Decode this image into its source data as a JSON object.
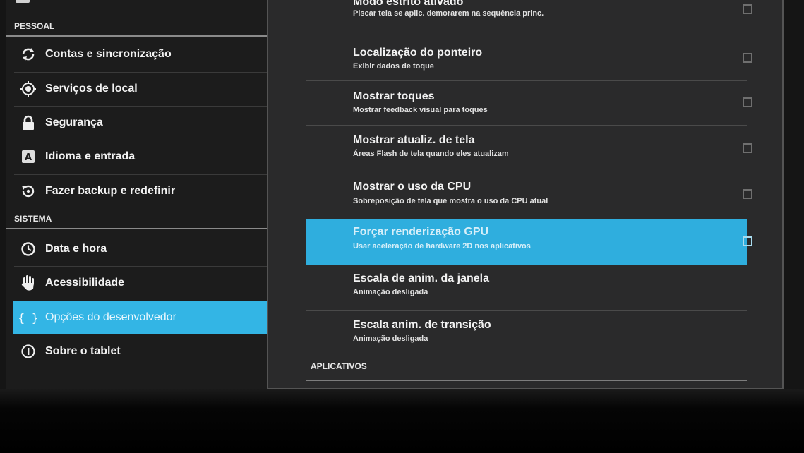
{
  "sidebar": {
    "section_personal": "PESSOAL",
    "section_system": "SISTEMA",
    "items": [
      {
        "label": "Contas e sincronização",
        "icon": "sync-icon"
      },
      {
        "label": "Serviços de local",
        "icon": "location-icon"
      },
      {
        "label": "Segurança",
        "icon": "lock-icon"
      },
      {
        "label": "Idioma e entrada",
        "icon": "language-icon"
      },
      {
        "label": "Fazer backup e redefinir",
        "icon": "backup-icon"
      },
      {
        "label": "Data e hora",
        "icon": "clock-icon"
      },
      {
        "label": "Acessibilidade",
        "icon": "hand-icon"
      },
      {
        "label": "Opções do desenvolvedor",
        "icon": "braces-icon",
        "selected": true
      },
      {
        "label": "Sobre o tablet",
        "icon": "info-icon"
      }
    ]
  },
  "prefs": [
    {
      "title": "Modo estrito ativado",
      "summary": "Piscar tela se aplic. demorarem na sequência princ.",
      "checkbox": true,
      "checked": false
    },
    {
      "title": "Localização do ponteiro",
      "summary": "Exibir dados de toque",
      "checkbox": true,
      "checked": false
    },
    {
      "title": "Mostrar toques",
      "summary": "Mostrar feedback visual para toques",
      "checkbox": true,
      "checked": false
    },
    {
      "title": "Mostrar atualiz. de tela",
      "summary": "Áreas Flash de tela quando eles atualizam",
      "checkbox": true,
      "checked": false
    },
    {
      "title": "Mostrar o uso da CPU",
      "summary": "Sobreposição de tela que mostra o uso da CPU atual",
      "checkbox": true,
      "checked": false
    },
    {
      "title": "Forçar renderização GPU",
      "summary": "Usar aceleração de hardware 2D nos aplicativos",
      "checkbox": true,
      "checked": false,
      "highlighted": true
    },
    {
      "title": "Escala de anim. da janela",
      "summary": "Animação desligada",
      "checkbox": false
    },
    {
      "title": "Escala anim. de transição",
      "summary": "Animação desligada",
      "checkbox": false
    }
  ],
  "category_apps": "APLICATIVOS",
  "colors": {
    "accent": "#33b5e5",
    "background": "#2a2a2b",
    "sidebar": "#1c1c1c"
  }
}
